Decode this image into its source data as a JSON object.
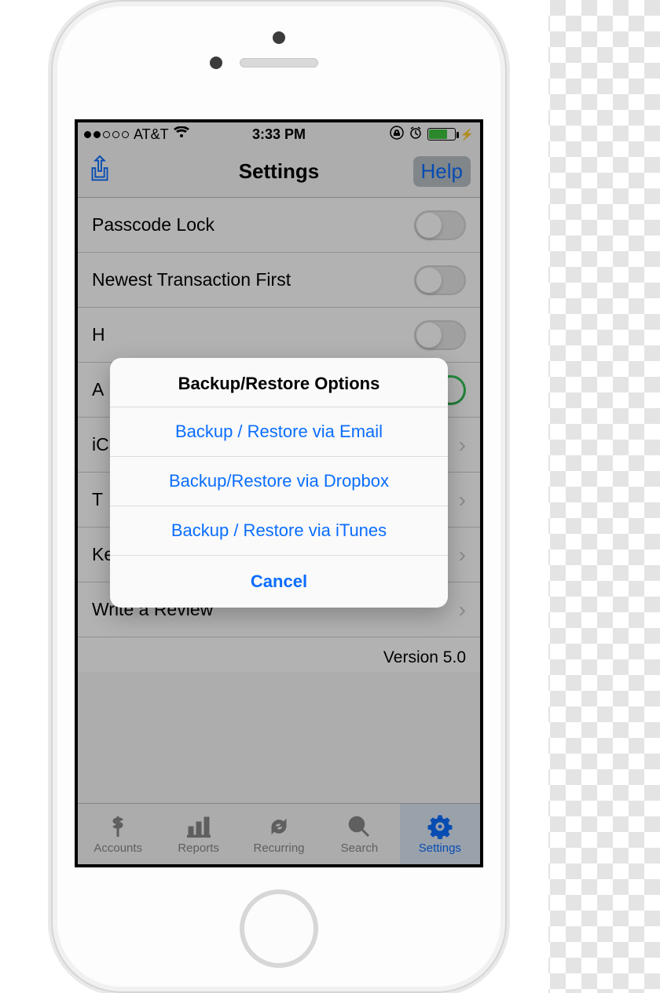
{
  "status_bar": {
    "carrier": "AT&T",
    "time": "3:33 PM"
  },
  "nav": {
    "title": "Settings",
    "help_label": "Help"
  },
  "rows": {
    "passcode": "Passcode Lock",
    "newest": "Newest Transaction First",
    "r2": "H",
    "r3": "A",
    "r4": "iC",
    "r5": "T",
    "keyboard": "Keyboard Options",
    "review": "Write a Review"
  },
  "version_label": "Version 5.0",
  "tabs": [
    {
      "label": "Accounts"
    },
    {
      "label": "Reports"
    },
    {
      "label": "Recurring"
    },
    {
      "label": "Search"
    },
    {
      "label": "Settings"
    }
  ],
  "sheet": {
    "title": "Backup/Restore Options",
    "opt_email": "Backup / Restore via Email",
    "opt_dropbox": "Backup/Restore via Dropbox",
    "opt_itunes": "Backup / Restore via iTunes",
    "cancel": "Cancel"
  }
}
